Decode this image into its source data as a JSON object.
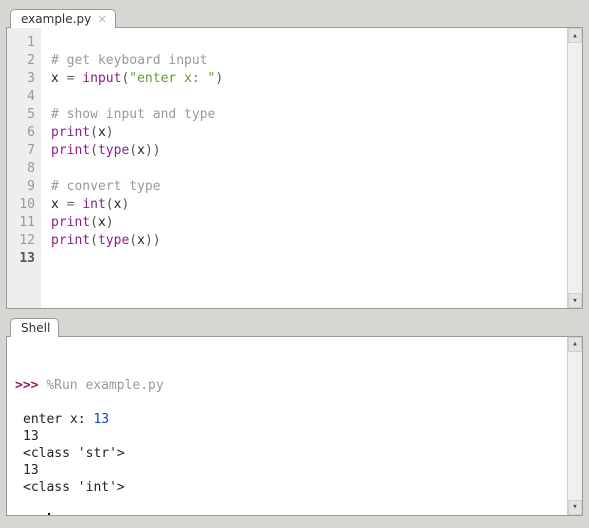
{
  "editor": {
    "tab_label": "example.py",
    "lines": [
      {
        "n": 1,
        "tokens": []
      },
      {
        "n": 2,
        "tokens": [
          {
            "cls": "comment",
            "t": "# get keyboard input"
          }
        ]
      },
      {
        "n": 3,
        "tokens": [
          {
            "cls": "ident",
            "t": "x "
          },
          {
            "cls": "op",
            "t": "= "
          },
          {
            "cls": "builtin",
            "t": "input"
          },
          {
            "cls": "paren",
            "t": "("
          },
          {
            "cls": "string",
            "t": "\"enter x: \""
          },
          {
            "cls": "paren",
            "t": ")"
          }
        ]
      },
      {
        "n": 4,
        "tokens": []
      },
      {
        "n": 5,
        "tokens": [
          {
            "cls": "comment",
            "t": "# show input and type"
          }
        ]
      },
      {
        "n": 6,
        "tokens": [
          {
            "cls": "builtin",
            "t": "print"
          },
          {
            "cls": "paren",
            "t": "("
          },
          {
            "cls": "ident",
            "t": "x"
          },
          {
            "cls": "paren",
            "t": ")"
          }
        ]
      },
      {
        "n": 7,
        "tokens": [
          {
            "cls": "builtin",
            "t": "print"
          },
          {
            "cls": "paren",
            "t": "("
          },
          {
            "cls": "builtin",
            "t": "type"
          },
          {
            "cls": "paren",
            "t": "("
          },
          {
            "cls": "ident",
            "t": "x"
          },
          {
            "cls": "paren",
            "t": ")"
          },
          {
            "cls": "paren",
            "t": ")"
          }
        ]
      },
      {
        "n": 8,
        "tokens": []
      },
      {
        "n": 9,
        "tokens": [
          {
            "cls": "comment",
            "t": "# convert type"
          }
        ]
      },
      {
        "n": 10,
        "tokens": [
          {
            "cls": "ident",
            "t": "x "
          },
          {
            "cls": "op",
            "t": "= "
          },
          {
            "cls": "builtin",
            "t": "int"
          },
          {
            "cls": "paren",
            "t": "("
          },
          {
            "cls": "ident",
            "t": "x"
          },
          {
            "cls": "paren",
            "t": ")"
          }
        ]
      },
      {
        "n": 11,
        "tokens": [
          {
            "cls": "builtin",
            "t": "print"
          },
          {
            "cls": "paren",
            "t": "("
          },
          {
            "cls": "ident",
            "t": "x"
          },
          {
            "cls": "paren",
            "t": ")"
          }
        ]
      },
      {
        "n": 12,
        "tokens": [
          {
            "cls": "builtin",
            "t": "print"
          },
          {
            "cls": "paren",
            "t": "("
          },
          {
            "cls": "builtin",
            "t": "type"
          },
          {
            "cls": "paren",
            "t": "("
          },
          {
            "cls": "ident",
            "t": "x"
          },
          {
            "cls": "paren",
            "t": ")"
          },
          {
            "cls": "paren",
            "t": ")"
          }
        ]
      },
      {
        "n": 13,
        "tokens": [],
        "current": true
      }
    ]
  },
  "shell": {
    "tab_label": "Shell",
    "prompt": ">>>",
    "lines": [
      {
        "type": "prompt-run",
        "cmd": "%Run example.py"
      },
      {
        "type": "blank"
      },
      {
        "type": "io",
        "pre": "enter x: ",
        "val": "13"
      },
      {
        "type": "out",
        "t": "13"
      },
      {
        "type": "out",
        "t": "<class 'str'>"
      },
      {
        "type": "out",
        "t": "13"
      },
      {
        "type": "out",
        "t": "<class 'int'>"
      },
      {
        "type": "blank"
      },
      {
        "type": "prompt-cursor"
      }
    ]
  },
  "glyphs": {
    "up": "▴",
    "down": "▾",
    "close": "×"
  }
}
